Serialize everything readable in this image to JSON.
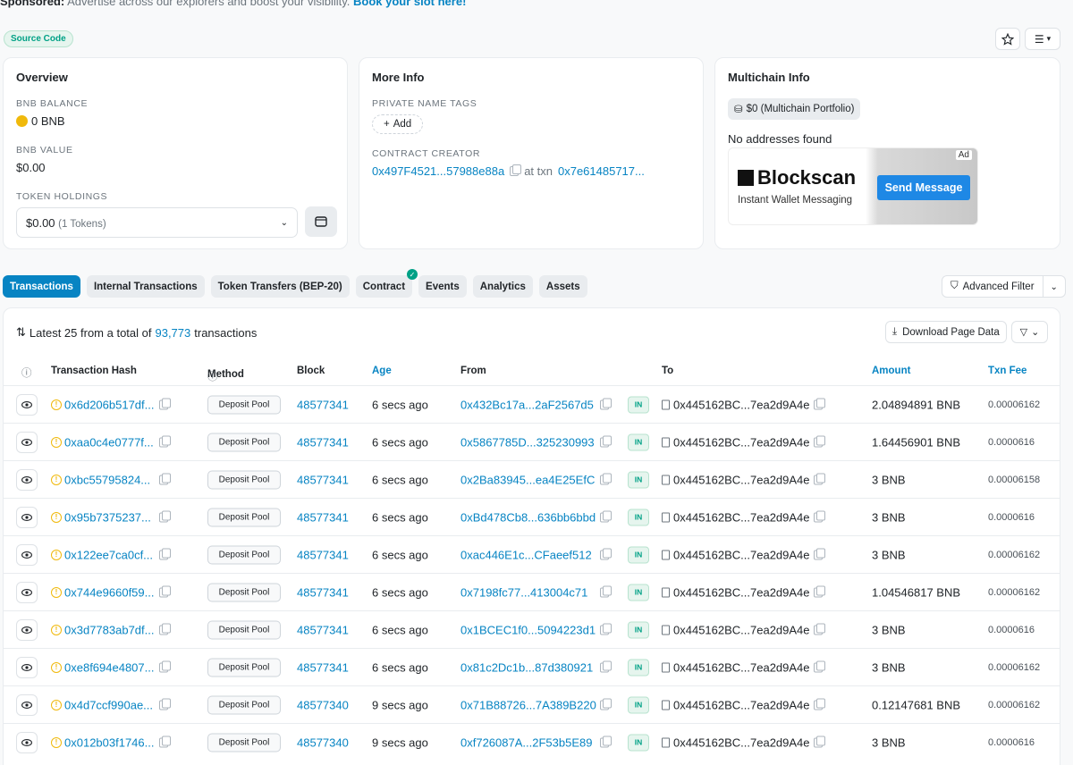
{
  "sponsor": {
    "prefix": "Sponsored:",
    "text": "Advertise across our explorers and boost your visibility.",
    "link": "Book your slot here!"
  },
  "source_code_badge": "Source Code",
  "overview": {
    "title": "Overview",
    "bnb_balance_label": "BNB BALANCE",
    "bnb_balance": "0 BNB",
    "bnb_value_label": "BNB VALUE",
    "bnb_value": "$0.00",
    "token_holdings_label": "TOKEN HOLDINGS",
    "token_holdings_value": "$0.00",
    "token_holdings_count": "(1 Tokens)"
  },
  "more_info": {
    "title": "More Info",
    "private_tags_label": "PRIVATE NAME TAGS",
    "add_label": "Add",
    "creator_label": "CONTRACT CREATOR",
    "creator_address": "0x497F4521...57988e88a",
    "at_txn": "at txn",
    "creator_txn": "0x7e61485717..."
  },
  "multichain": {
    "title": "Multichain Info",
    "portfolio": "$0 (Multichain Portfolio)",
    "no_addresses": "No addresses found",
    "ad": {
      "brand": "Blockscan",
      "subtitle": "Instant Wallet Messaging",
      "cta": "Send Message",
      "tag": "Ad"
    }
  },
  "tabs": [
    {
      "label": "Transactions",
      "active": true
    },
    {
      "label": "Internal Transactions"
    },
    {
      "label": "Token Transfers (BEP-20)"
    },
    {
      "label": "Contract",
      "verified": true
    },
    {
      "label": "Events"
    },
    {
      "label": "Analytics"
    },
    {
      "label": "Assets"
    }
  ],
  "advanced_filter": "Advanced Filter",
  "table": {
    "summary_prefix": "Latest 25 from a total of",
    "summary_count": "93,773",
    "summary_suffix": "transactions",
    "download_label": "Download Page Data",
    "headers": {
      "hash": "Transaction Hash",
      "method": "Method",
      "block": "Block",
      "age": "Age",
      "from": "From",
      "to": "To",
      "amount": "Amount",
      "fee": "Txn Fee"
    },
    "rows": [
      {
        "hash": "0x6d206b517df...",
        "method": "Deposit Pool",
        "block": "48577341",
        "age": "6 secs ago",
        "from": "0x432Bc17a...2aF2567d5",
        "direction": "IN",
        "to": "0x445162BC...7ea2d9A4e",
        "amount": "2.04894891 BNB",
        "fee": "0.00006162"
      },
      {
        "hash": "0xaa0c4e0777f...",
        "method": "Deposit Pool",
        "block": "48577341",
        "age": "6 secs ago",
        "from": "0x5867785D...325230993",
        "direction": "IN",
        "to": "0x445162BC...7ea2d9A4e",
        "amount": "1.64456901 BNB",
        "fee": "0.0000616"
      },
      {
        "hash": "0xbc55795824...",
        "method": "Deposit Pool",
        "block": "48577341",
        "age": "6 secs ago",
        "from": "0x2Ba83945...ea4E25EfC",
        "direction": "IN",
        "to": "0x445162BC...7ea2d9A4e",
        "amount": "3 BNB",
        "fee": "0.00006158"
      },
      {
        "hash": "0x95b7375237...",
        "method": "Deposit Pool",
        "block": "48577341",
        "age": "6 secs ago",
        "from": "0xBd478Cb8...636bb6bbd",
        "direction": "IN",
        "to": "0x445162BC...7ea2d9A4e",
        "amount": "3 BNB",
        "fee": "0.0000616"
      },
      {
        "hash": "0x122ee7ca0cf...",
        "method": "Deposit Pool",
        "block": "48577341",
        "age": "6 secs ago",
        "from": "0xac446E1c...CFaeef512",
        "direction": "IN",
        "to": "0x445162BC...7ea2d9A4e",
        "amount": "3 BNB",
        "fee": "0.00006162"
      },
      {
        "hash": "0x744e9660f59...",
        "method": "Deposit Pool",
        "block": "48577341",
        "age": "6 secs ago",
        "from": "0x7198fc77...413004c71",
        "direction": "IN",
        "to": "0x445162BC...7ea2d9A4e",
        "amount": "1.04546817 BNB",
        "fee": "0.00006162"
      },
      {
        "hash": "0x3d7783ab7df...",
        "method": "Deposit Pool",
        "block": "48577341",
        "age": "6 secs ago",
        "from": "0x1BCEC1f0...5094223d1",
        "direction": "IN",
        "to": "0x445162BC...7ea2d9A4e",
        "amount": "3 BNB",
        "fee": "0.0000616"
      },
      {
        "hash": "0xe8f694e4807...",
        "method": "Deposit Pool",
        "block": "48577341",
        "age": "6 secs ago",
        "from": "0x81c2Dc1b...87d380921",
        "direction": "IN",
        "to": "0x445162BC...7ea2d9A4e",
        "amount": "3 BNB",
        "fee": "0.00006162"
      },
      {
        "hash": "0x4d7ccf990ae...",
        "method": "Deposit Pool",
        "block": "48577340",
        "age": "9 secs ago",
        "from": "0x71B88726...7A389B220",
        "direction": "IN",
        "to": "0x445162BC...7ea2d9A4e",
        "amount": "0.12147681 BNB",
        "fee": "0.00006162"
      },
      {
        "hash": "0x012b03f1746...",
        "method": "Deposit Pool",
        "block": "48577340",
        "age": "9 secs ago",
        "from": "0xf726087A...2F53b5E89",
        "direction": "IN",
        "to": "0x445162BC...7ea2d9A4e",
        "amount": "3 BNB",
        "fee": "0.0000616"
      }
    ]
  },
  "colors": {
    "primary": "#0784c3",
    "success": "#00a186",
    "warning": "#f0b90b"
  }
}
